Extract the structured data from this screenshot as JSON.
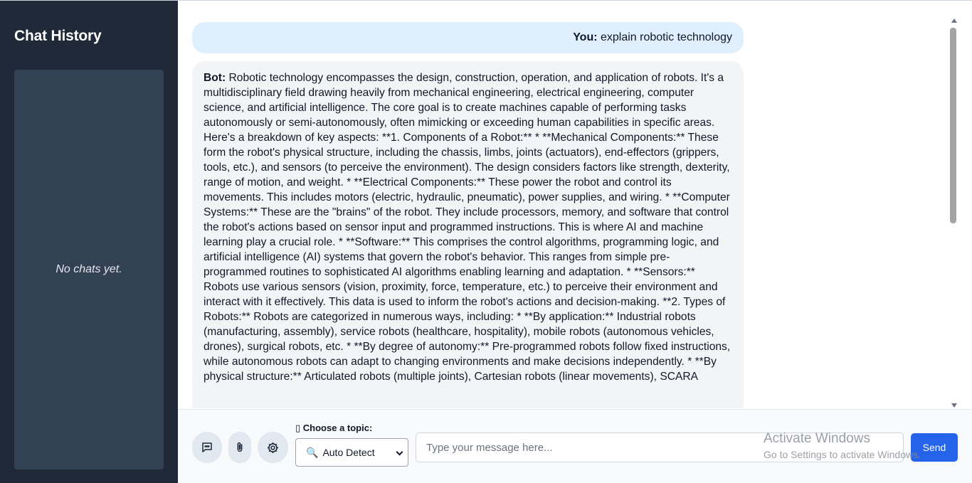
{
  "sidebar": {
    "title": "Chat History",
    "empty_text": "No chats yet."
  },
  "chat": {
    "messages": [
      {
        "role_label": "You:",
        "text": " explain robotic technology"
      },
      {
        "role_label": "Bot:",
        "text": " Robotic technology encompasses the design, construction, operation, and application of robots. It's a multidisciplinary field drawing heavily from mechanical engineering, electrical engineering, computer science, and artificial intelligence. The core goal is to create machines capable of performing tasks autonomously or semi-autonomously, often mimicking or exceeding human capabilities in specific areas. Here's a breakdown of key aspects: **1. Components of a Robot:** * **Mechanical Components:** These form the robot's physical structure, including the chassis, limbs, joints (actuators), end-effectors (grippers, tools, etc.), and sensors (to perceive the environment). The design considers factors like strength, dexterity, range of motion, and weight. * **Electrical Components:** These power the robot and control its movements. This includes motors (electric, hydraulic, pneumatic), power supplies, and wiring. * **Computer Systems:** These are the \"brains\" of the robot. They include processors, memory, and software that control the robot's actions based on sensor input and programmed instructions. This is where AI and machine learning play a crucial role. * **Software:** This comprises the control algorithms, programming logic, and artificial intelligence (AI) systems that govern the robot's behavior. This ranges from simple pre-programmed routines to sophisticated AI algorithms enabling learning and adaptation. * **Sensors:** Robots use various sensors (vision, proximity, force, temperature, etc.) to perceive their environment and interact with it effectively. This data is used to inform the robot's actions and decision-making. **2. Types of Robots:** Robots are categorized in numerous ways, including: * **By application:** Industrial robots (manufacturing, assembly), service robots (healthcare, hospitality), mobile robots (autonomous vehicles, drones), surgical robots, etc. * **By degree of autonomy:** Pre-programmed robots follow fixed instructions, while autonomous robots can adapt to changing environments and make decisions independently. * **By physical structure:** Articulated robots (multiple joints), Cartesian robots (linear movements), SCARA"
      }
    ]
  },
  "composer": {
    "icons": [
      "chat-bubble-icon",
      "paperclip-icon",
      "gear-icon"
    ],
    "topic_label": "Choose a topic:",
    "topic_label_icon": "▯",
    "topic_selected_icon": "🔍",
    "topic_selected": "Auto Detect",
    "input_placeholder": "Type your message here...",
    "send_label": "Send"
  },
  "watermark": {
    "title": "Activate Windows",
    "subtitle": "Go to Settings to activate Windows."
  },
  "colors": {
    "sidebar_bg": "#1f2937",
    "sidebar_panel": "#334155",
    "user_bubble": "#dfeffc",
    "bot_bubble": "#f3f4f6",
    "send_button": "#2563eb"
  }
}
